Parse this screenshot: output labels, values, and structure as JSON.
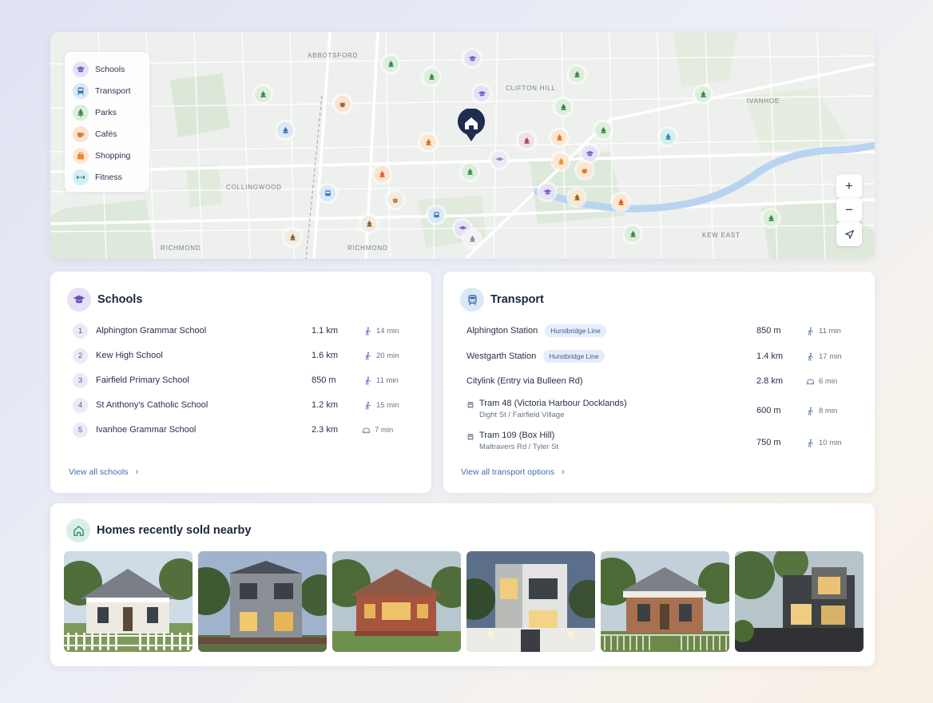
{
  "map": {
    "legend": [
      {
        "label": "Schools",
        "icon": "graduation-cap-icon",
        "color": "#7b62c9",
        "bg": "#e7e1f6"
      },
      {
        "label": "Transport",
        "icon": "train-icon",
        "color": "#3b78b8",
        "bg": "#dbe8f6"
      },
      {
        "label": "Parks",
        "icon": "tree-icon",
        "color": "#3f8a4c",
        "bg": "#dcefdd"
      },
      {
        "label": "Cafés",
        "icon": "cup-icon",
        "color": "#e07a3a",
        "bg": "#fbe3d2"
      },
      {
        "label": "Shopping",
        "icon": "shopping-bag-icon",
        "color": "#ea8a2e",
        "bg": "#fde7cf"
      },
      {
        "label": "Fitness",
        "icon": "dumbbell-icon",
        "color": "#2c9a9a",
        "bg": "#d5efee"
      }
    ],
    "area_labels": [
      "ABBOTSFORD",
      "CLIFTON HILL",
      "RICHMOND",
      "IVANHOE",
      "COLLINGWOOD",
      "KEW EAST",
      "RICHMOND"
    ],
    "controls": {
      "zoom_in": "+",
      "zoom_out": "−",
      "locate": "locate-icon"
    }
  },
  "schools": {
    "title": "Schools",
    "items": [
      {
        "rank": "1",
        "name": "Alphington Grammar School",
        "distance": "1.1 km",
        "time": "14 min",
        "mode": "walk"
      },
      {
        "rank": "2",
        "name": "Kew High School",
        "distance": "1.6 km",
        "time": "20 min",
        "mode": "walk"
      },
      {
        "rank": "3",
        "name": "Fairfield Primary School",
        "distance": "850 m",
        "time": "11 min",
        "mode": "walk"
      },
      {
        "rank": "4",
        "name": "St Anthony's Catholic School",
        "distance": "1.2 km",
        "time": "15 min",
        "mode": "walk"
      },
      {
        "rank": "5",
        "name": "Ivanhoe Grammar School",
        "distance": "2.3 km",
        "time": "7 min",
        "mode": "car"
      }
    ],
    "view_all": "View all schools"
  },
  "transport": {
    "title": "Transport",
    "items": [
      {
        "name": "Alphington Station",
        "tag": "Hurstbridge Line",
        "sub": "",
        "distance": "850 m",
        "time": "11 min",
        "mode": "walk"
      },
      {
        "name": "Westgarth Station",
        "tag": "Hurstbridge Line",
        "sub": "",
        "distance": "1.4 km",
        "time": "17 min",
        "mode": "walk"
      },
      {
        "name": "Citylink (Entry via Bulleen Rd)",
        "tag": "",
        "sub": "",
        "distance": "2.8 km",
        "time": "6 min",
        "mode": "car"
      },
      {
        "name": "Tram 48 (Victoria Harbour Docklands)",
        "tag": "",
        "sub": "Dight St / Fairfield Village",
        "distance": "600 m",
        "time": "8 min",
        "mode": "walk"
      },
      {
        "name": "Tram 109 (Box Hill)",
        "tag": "",
        "sub": "Maltravers Rd / Tyler St",
        "distance": "750 m",
        "time": "10 min",
        "mode": "walk"
      }
    ],
    "view_all": "View all transport options"
  },
  "homes": {
    "title": "Homes recently sold nearby",
    "photos": [
      "victorian-cottage",
      "modern-two-storey",
      "red-brick-bungalow",
      "modern-white-box",
      "federation-cottage",
      "contemporary-dark"
    ]
  }
}
